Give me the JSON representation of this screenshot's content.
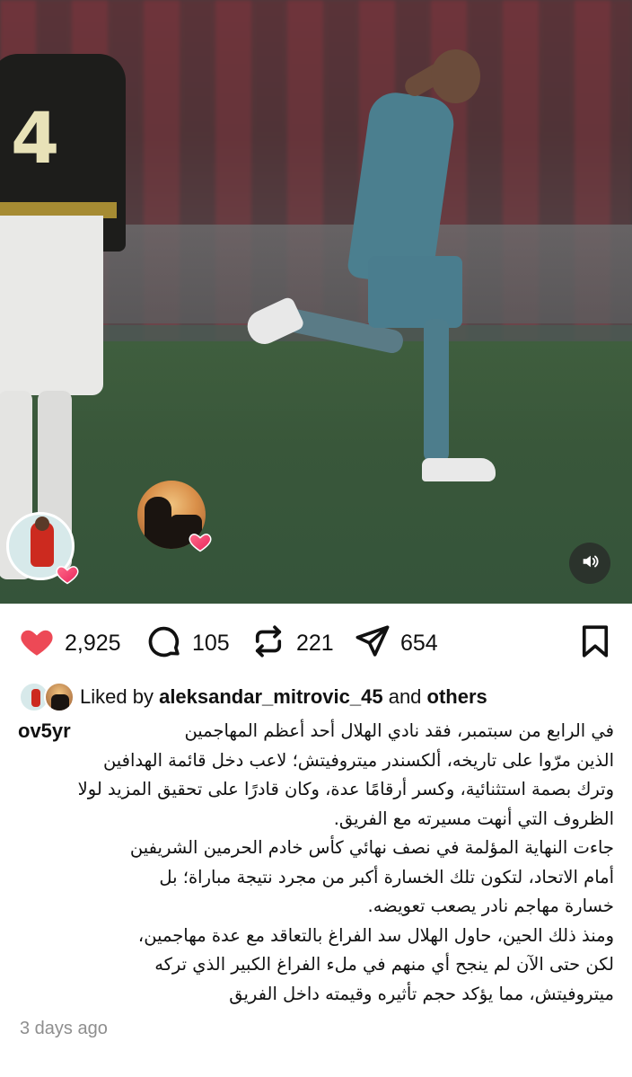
{
  "post": {
    "media_alt": "football match video frame",
    "sound_icon": "speaker-icon"
  },
  "actions": {
    "likes": "2,925",
    "comments": "105",
    "reposts": "221",
    "shares": "654",
    "like_icon": "heart-filled-icon",
    "like_color": "#ed4956",
    "comment_icon": "comment-bubble-icon",
    "repost_icon": "repost-arrows-icon",
    "share_icon": "paper-plane-icon",
    "save_icon": "bookmark-icon"
  },
  "liked_by": {
    "prefix": "Liked by",
    "user": "aleksandar_mitrovic_45",
    "joiner": "and",
    "others": "others"
  },
  "caption": {
    "username": "ov5yr",
    "line1": "في الرابع من سبتمبر، فقد نادي الهلال أحد أعظم المهاجمين",
    "line2": "الذين مرّوا على تاريخه، ألكسندر ميتروفيتش؛ لاعب دخل قائمة الهدافين",
    "line3": "وترك بصمة استثنائية، وكسر أرقامًا عدة، وكان قادرًا على تحقيق المزيد لولا",
    "line4": "الظروف التي أنهت مسيرته مع الفريق.",
    "line5": "جاءت النهاية المؤلمة في نصف نهائي كأس خادم الحرمين الشريفين",
    "line6": "أمام الاتحاد، لتكون تلك الخسارة أكبر من مجرد نتيجة مباراة؛ بل",
    "line7": "خسارة مهاجم نادر يصعب تعويضه.",
    "line8": "ومنذ ذلك الحين، حاول الهلال سد الفراغ بالتعاقد مع عدة مهاجمين،",
    "line9": "لكن حتى الآن لم ينجح أي منهم في ملء الفراغ الكبير الذي تركه",
    "line10": "ميتروفيتش، مما يؤكد حجم تأثيره وقيمته داخل الفريق"
  },
  "timestamp": "3 days ago"
}
